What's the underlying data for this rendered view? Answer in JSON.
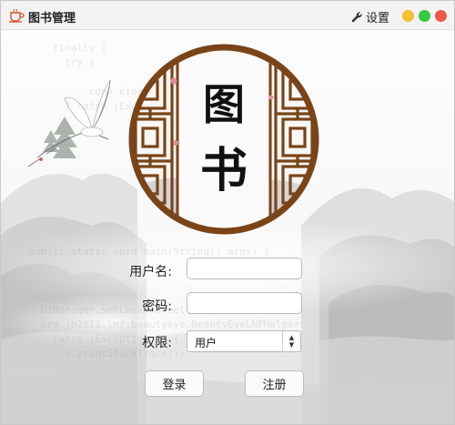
{
  "window": {
    "title": "图书管理",
    "settings_label": "设置"
  },
  "logo": {
    "char_top": "图",
    "char_bottom": "书"
  },
  "form": {
    "username_label": "用户名:",
    "username_value": "",
    "password_label": "密码:",
    "password_value": "",
    "role_label": "权限:",
    "role_selected": "用户"
  },
  "buttons": {
    "login": "登录",
    "register": "注册"
  },
  "watermark_code": "        finally {\n          try {\n\n              conn.closeCon(con);\n          } catch (Exception e1) {\n\n\n\n\n\n\n\n\n\n    public static void main(String[] args) {\n\n\n\n      UIManager.setLookAndFeel(...);\n      org.jb2011.lnf.beautyeye.BeautyEyeLNFHelper\n        catch (Exception e) {\n          e.printStackTrace();",
  "colors": {
    "window_dot_minimize": "#f6c02f",
    "window_dot_maximize": "#35c93e",
    "window_dot_close": "#f2564c",
    "frame_wood": "#7a4418"
  }
}
